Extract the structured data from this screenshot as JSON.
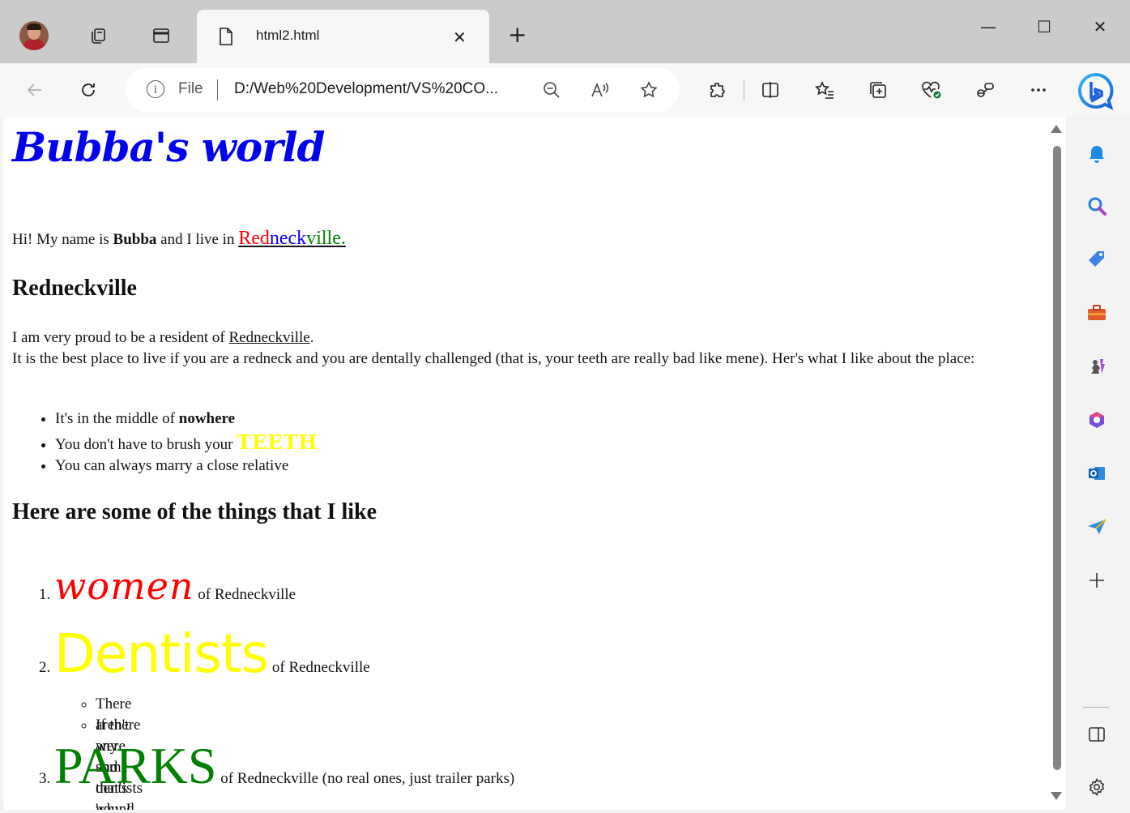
{
  "browser": {
    "tab": {
      "title": "html2.html",
      "close_glyph": "✕"
    },
    "newtab_glyph": "+",
    "window_controls": {
      "minimize": "—",
      "maximize": "☐",
      "close": "✕"
    },
    "address": {
      "scheme_label": "File",
      "url": "D:/Web%20Development/VS%20CO..."
    },
    "icons": [
      "profile-avatar",
      "workspaces-icon",
      "tab-actions-icon",
      "back-icon",
      "refresh-icon",
      "info-icon",
      "zoom-out-icon",
      "read-aloud-icon",
      "favorite-star-icon",
      "extensions-icon",
      "split-screen-icon",
      "favorites-icon",
      "collections-icon",
      "browser-essentials-icon",
      "copilot-icon",
      "more-icon",
      "bing-icon"
    ],
    "sidebar_icons": [
      "notifications-icon",
      "search-icon",
      "shopping-icon",
      "tools-icon",
      "games-icon",
      "microsoft365-icon",
      "outlook-icon",
      "drop-icon",
      "add-icon",
      "sidebar-toggle-icon",
      "settings-icon"
    ]
  },
  "page": {
    "heading": "Bubba's world",
    "intro": {
      "a": "Hi! My name is ",
      "name": "Bubba",
      "b": " and I live in ",
      "rn1": "Red",
      "rn2": "neck",
      "rn3": "ville."
    },
    "section1_title": "Redneckville",
    "para": {
      "a": "I am very proud to be a resident of ",
      "link": "Redneckville",
      "b": ".",
      "c": "It is the best place to live if you are a redneck and you are dentally challenged (that is, your teeth are really bad like mene). Her's what I like about the place:"
    },
    "list1": {
      "i1a": "It's in the middle of ",
      "i1b": "nowhere",
      "i2a": "You don't have to brush your ",
      "i2b": "TEETH",
      "i3": "You can always marry a close relative"
    },
    "section2_title": "Here are some of the things that I like",
    "ol": [
      {
        "num": "1.",
        "big": "women",
        "rest": " of Redneckville"
      },
      {
        "num": "2.",
        "big": "Dentists",
        "rest": " of Redneckville"
      },
      {
        "num": "3.",
        "big": "PARKS",
        "rest": " of Redneckville (no real ones, just trailer parks)"
      }
    ],
    "sub": [
      "There aren't any and that's why I like them",
      "If there were some dentists 'round here I ain't gonna like'em at all"
    ],
    "colors": {
      "heading": "#0000ee",
      "red": "#ff0000",
      "blue": "#0000ff",
      "green": "#008000",
      "yellow": "#ffff00"
    }
  }
}
